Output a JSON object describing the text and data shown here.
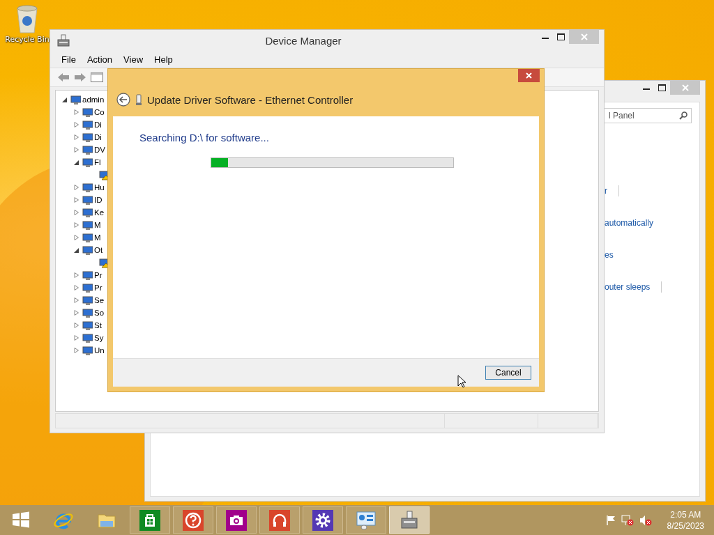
{
  "desktop": {
    "icons": [
      {
        "label": "Recycle Bin"
      }
    ]
  },
  "device_manager": {
    "title": "Device Manager",
    "menu": [
      "File",
      "Action",
      "View",
      "Help"
    ],
    "tree": {
      "label": "admin",
      "expanded": true,
      "children": [
        {
          "label": "Co",
          "expanded": false
        },
        {
          "label": "Di",
          "expanded": false
        },
        {
          "label": "Di",
          "expanded": false
        },
        {
          "label": "DV",
          "expanded": false
        },
        {
          "label": "Fl",
          "expanded": true,
          "children": [
            {
              "warning": true
            }
          ]
        },
        {
          "label": "Hu",
          "expanded": false
        },
        {
          "label": "ID",
          "expanded": false
        },
        {
          "label": "Ke",
          "expanded": false
        },
        {
          "label": "M",
          "expanded": false
        },
        {
          "label": "M",
          "expanded": false
        },
        {
          "label": "Ot",
          "expanded": true,
          "children": [
            {
              "warning": true
            }
          ]
        },
        {
          "label": "Pr",
          "expanded": false
        },
        {
          "label": "Pr",
          "expanded": false
        },
        {
          "label": "Se",
          "expanded": false
        },
        {
          "label": "So",
          "expanded": false
        },
        {
          "label": "St",
          "expanded": false
        },
        {
          "label": "Sy",
          "expanded": false
        },
        {
          "label": "Un",
          "expanded": false
        }
      ]
    }
  },
  "control_panel": {
    "search": {
      "placeholder": "l Panel"
    },
    "links": [
      {
        "text": "r",
        "divider": true
      },
      {
        "text": "automatically",
        "divider": false
      },
      {
        "text": "es",
        "divider": false
      },
      {
        "text": "outer sleeps",
        "divider": true
      }
    ]
  },
  "dialog": {
    "title": "Update Driver Software - Ethernet Controller",
    "heading": "Searching D:\\ for software...",
    "progress": {
      "level": 0.07
    },
    "buttons": [
      "Cancel"
    ]
  },
  "taskbar": {
    "apps": [
      {
        "kind": "start",
        "running": false,
        "selected": false
      },
      {
        "kind": "browser",
        "running": false,
        "selected": false
      },
      {
        "kind": "folder",
        "running": false,
        "selected": false
      },
      {
        "kind": "store",
        "running": true,
        "selected": false
      },
      {
        "kind": "help",
        "running": true,
        "selected": false
      },
      {
        "kind": "camera",
        "running": true,
        "selected": false
      },
      {
        "kind": "music",
        "running": true,
        "selected": false
      },
      {
        "kind": "settings",
        "running": true,
        "selected": false
      },
      {
        "kind": "panel",
        "running": true,
        "selected": false
      },
      {
        "kind": "device",
        "running": true,
        "selected": true
      }
    ],
    "clock": {
      "time": "2:05 AM",
      "date": "8/25/2023"
    }
  }
}
